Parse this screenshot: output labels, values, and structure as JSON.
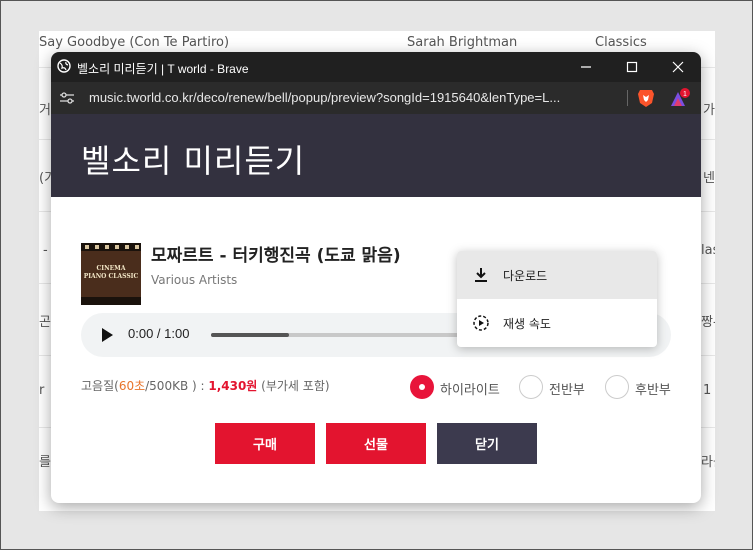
{
  "background_list": {
    "rows": [
      {
        "title": "Say Goodbye (Con Te Partiro)",
        "artist": "Sarah Brightman",
        "genre": "Classics"
      },
      {
        "title": "거",
        "artist": "",
        "genre": "가"
      },
      {
        "title": "(가",
        "artist": "",
        "genre": "넨설"
      },
      {
        "title": "-",
        "artist": "",
        "genre": "lass"
      },
      {
        "title": "곤둘",
        "artist": "",
        "genre": "짱-"
      },
      {
        "title": "r",
        "artist": "",
        "genre": "1"
      },
      {
        "title": "를",
        "artist": "",
        "genre": "라를"
      }
    ]
  },
  "browser": {
    "window_title": "벨소리 미리듣기 | T world - Brave",
    "url": "music.tworld.co.kr/deco/renew/bell/popup/preview?songId=1915640&lenType=L...",
    "rewards_badge": "1",
    "minimize_icon": "minimize-icon",
    "maximize_icon": "maximize-icon",
    "close_icon": "close-icon"
  },
  "popup": {
    "header_title": "벨소리 미리듣기",
    "song_title": "모짜르트 - 터키행진곡 (도쿄 맑음)",
    "artist": "Various Artists",
    "album_art_text_1": "CINEMA",
    "album_art_text_2": "PIANO CLASSIC",
    "player": {
      "time": "0:00 / 1:00",
      "progress_fraction": 0.3
    },
    "price": {
      "quality_label": "고음질(",
      "duration": "60초",
      "size_suffix": "/500KB ) : ",
      "price": "1,430원",
      "tax_note": " (부가세 포함)"
    },
    "options": [
      {
        "label": "하이라이트",
        "selected": true
      },
      {
        "label": "전반부",
        "selected": false
      },
      {
        "label": "후반부",
        "selected": false
      }
    ],
    "buttons": {
      "buy": "구매",
      "gift": "선물",
      "close": "닫기"
    },
    "context_menu": {
      "items": [
        {
          "label": "다운로드",
          "icon": "download-icon"
        },
        {
          "label": "재생 속도",
          "icon": "playback-speed-icon"
        }
      ]
    }
  },
  "colors": {
    "accent_red": "#e3142f",
    "header_dark": "#33313f",
    "close_button": "#3c3a4e",
    "price_orange": "#e8742a"
  }
}
